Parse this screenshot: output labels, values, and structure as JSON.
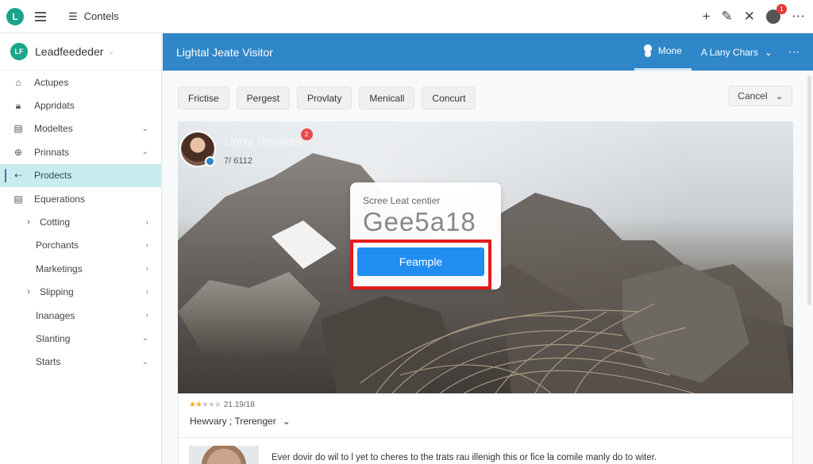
{
  "topbar": {
    "app_initial": "L",
    "menu_label": "Contels"
  },
  "sidebar": {
    "brand_logo": "LF",
    "brand_name": "Leadfeededer",
    "items": [
      {
        "label": "Actupes",
        "icon": "home-icon"
      },
      {
        "label": "Appridats",
        "icon": "lock-icon"
      },
      {
        "label": "Modeltes",
        "icon": "grid-icon"
      },
      {
        "label": "Prinnats",
        "icon": "globe-icon"
      },
      {
        "label": "Prodects",
        "icon": "arrow-icon"
      },
      {
        "label": "Equerations",
        "icon": "document-icon"
      },
      {
        "label": "Cotting"
      },
      {
        "label": "Porchants"
      },
      {
        "label": "Marketings"
      },
      {
        "label": "Slipping"
      },
      {
        "label": "Inanages"
      },
      {
        "label": "Slanting"
      },
      {
        "label": "Starts"
      }
    ]
  },
  "header": {
    "title": "Lightal Jeate Visitor",
    "tab_user": "Mone",
    "tab_charts": "A Lany Chars"
  },
  "filters": [
    "Frictise",
    "Pergest",
    "Provlaty",
    "Menicall",
    "Concurt"
  ],
  "cancel_label": "Cancel",
  "post": {
    "author": "Ligrry Reaifers",
    "badge_count": "2",
    "date": "7/ 6112"
  },
  "card": {
    "label": "Scree Leat centier",
    "value": "Gee5a18",
    "button": "Feample"
  },
  "below": {
    "rating_text": "21.19/18",
    "stars_filled": 2,
    "stars_total": 5,
    "sort_label": "Hewvary ; Trerenger",
    "comment": "Ever dovir do wil to l yet to cheres to the trats rau illenigh this or fice la comile manly do to witer."
  },
  "colors": {
    "header_bg": "#2f86c9",
    "active_nav_bg": "#c9ecef",
    "card_button": "#1f8df2",
    "highlight_border": "#e21b1b",
    "notification": "#e03b3b"
  },
  "notification_count": "1"
}
